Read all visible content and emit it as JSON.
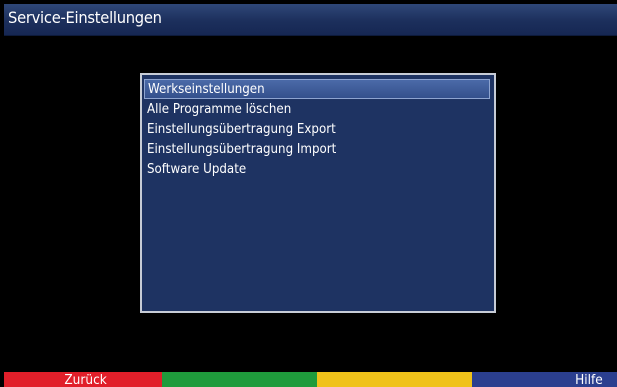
{
  "header": {
    "title": "Service-Einstellungen"
  },
  "menu": {
    "selected_index": 0,
    "items": [
      {
        "label": "Werkseinstellungen"
      },
      {
        "label": "Alle Programme löschen"
      },
      {
        "label": "Einstellungsübertragung Export"
      },
      {
        "label": "Einstellungsübertragung Import"
      },
      {
        "label": "Software Update"
      }
    ]
  },
  "footer": {
    "keys": [
      {
        "color_name": "red",
        "color": "#e11f2a",
        "label": "Zurück"
      },
      {
        "color_name": "green",
        "color": "#1f9b3c",
        "label": ""
      },
      {
        "color_name": "yellow",
        "color": "#f0c21a",
        "label": ""
      },
      {
        "color_name": "blue",
        "color": "#2b3f8f",
        "label": "Hilfe"
      }
    ]
  },
  "colors": {
    "background": "#000000",
    "title_bar": "#1c2f5c",
    "panel": "#1e3362",
    "panel_border": "#c7ccd6",
    "selection": "#4b6aa8",
    "text": "#ffffff"
  }
}
